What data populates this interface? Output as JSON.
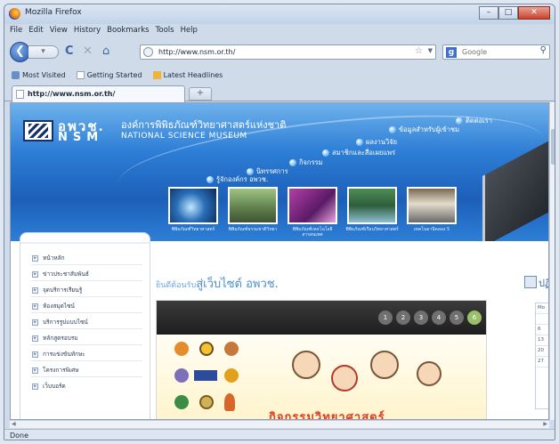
{
  "window": {
    "title": "Mozilla Firefox",
    "buttons": {
      "minimize": "–",
      "maximize": "□",
      "close": "✕"
    }
  },
  "menubar": [
    "File",
    "Edit",
    "View",
    "History",
    "Bookmarks",
    "Tools",
    "Help"
  ],
  "navbar": {
    "back_glyph": "❮",
    "forward_glyph": "▾",
    "reload_glyph": "C",
    "stop_glyph": "✕",
    "home_glyph": "⌂",
    "url": "http://www.nsm.or.th/",
    "bookmark_star": "☆",
    "search_placeholder": "Google",
    "search_engine_glyph": "g"
  },
  "bookmarks": [
    {
      "label": "Most Visited",
      "icon": "most-visited-icon"
    },
    {
      "label": "Getting Started",
      "icon": "page-icon"
    },
    {
      "label": "Latest Headlines",
      "icon": "rss-folder-icon"
    }
  ],
  "tab": {
    "label": "http://www.nsm.or.th/",
    "new_tab_glyph": "+"
  },
  "site": {
    "logo_thai": "อพวช.",
    "logo_abbr": "NSM",
    "org_thai": "องค์การพิพิธภัณฑ์วิทยาศาสตร์แห่งชาติ",
    "org_en": "NATIONAL SCIENCE MUSEUM",
    "top_nav": [
      "ติดต่อเรา",
      "ข้อมูลสำหรับผู้เข้าชม",
      "ผลงานวิจัย",
      "สมาชิกและสื่อเผยแพร่",
      "กิจกรรม",
      "นิทรรศการ",
      "รู้จักองค์กร อพวช."
    ],
    "thumbnails": [
      {
        "caption": "พิพิธภัณฑ์วิทยาศาสตร์"
      },
      {
        "caption": "พิพิธภัณฑ์ธรรมชาติวิทยา"
      },
      {
        "caption": "พิพิธภัณฑ์เทคโนโลยีสารสนเทศ"
      },
      {
        "caption": "พิพิธภัณฑ์เรือนวิทยาศาสตร์"
      },
      {
        "caption": "เทคโนธานีคลอง 5"
      }
    ],
    "left_menu": [
      "หน้าหลัก",
      "ข่าวประชาสัมพันธ์",
      "จุดบริการเรียนรู้",
      "ห้องสมุดไซน์",
      "บริการรูปแบบไซน์",
      "หลักสูตรอบรม",
      "การแข่งขันทักษะ",
      "โครงการพิเศษ",
      "เว็บบอร์ด"
    ],
    "welcome_prefix": "ยินดีต้อนรับ",
    "welcome_main": "สู่เว็บไซต์ อพวช.",
    "pager": [
      "1",
      "2",
      "3",
      "4",
      "5",
      "6"
    ],
    "slide_title": "กิจกรรมวิทยาศาสตร์",
    "right_label": "ปฏิทิน",
    "calendar_cells": [
      "Mo",
      "",
      "6",
      "13",
      "20",
      "27"
    ]
  },
  "status": "Done",
  "colors": {
    "banner": "#2d7ed6",
    "accent": "#4a8fd0",
    "slide_title": "#e23a1c",
    "pager_active": "#9bc06a"
  }
}
